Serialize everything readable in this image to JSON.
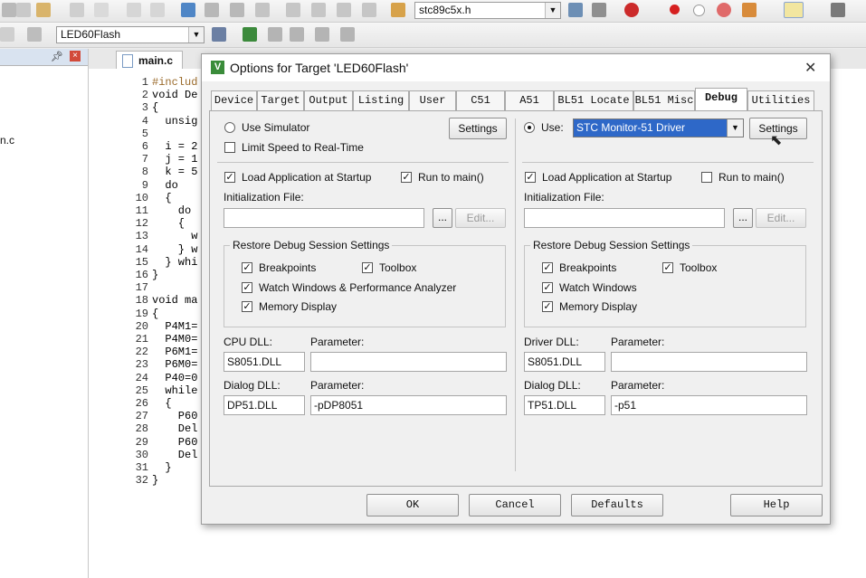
{
  "toolbar1": {
    "file_combo": "stc89c5x.h"
  },
  "toolbar2": {
    "target_combo": "LED60Flash"
  },
  "editor": {
    "file_tab": "main.c",
    "panel_file_fragment": "n.c",
    "line_numbers": [
      "1",
      "2",
      "3",
      "4",
      "5",
      "6",
      "7",
      "8",
      "9",
      "10",
      "11",
      "12",
      "13",
      "14",
      "15",
      "16",
      "17",
      "18",
      "19",
      "20",
      "21",
      "22",
      "23",
      "24",
      "25",
      "26",
      "27",
      "28",
      "29",
      "30",
      "31",
      "32"
    ],
    "code_lines": [
      "#includ",
      "void De",
      "{",
      "  unsig",
      "",
      "  i = 2",
      "  j = 1",
      "  k = 5",
      "  do",
      "  {",
      "    do",
      "    {",
      "      w",
      "    } w",
      "  } whi",
      "}",
      "",
      "void ma",
      "{",
      "  P4M1=",
      "  P4M0=",
      "  P6M1=",
      "  P6M0=",
      "  P40=0",
      "  while",
      "  {",
      "    P60",
      "    Del",
      "    P60",
      "    Del",
      "  }",
      "}"
    ]
  },
  "dialog": {
    "title": "Options for Target 'LED60Flash'",
    "tabs": [
      "Device",
      "Target",
      "Output",
      "Listing",
      "User",
      "C51",
      "A51",
      "BL51 Locate",
      "BL51 Misc",
      "Debug",
      "Utilities"
    ],
    "active_tab": "Debug",
    "left": {
      "use_simulator": "Use Simulator",
      "settings": "Settings",
      "limit_speed": "Limit Speed to Real-Time",
      "load_app": "Load Application at Startup",
      "run_to_main": "Run to main()",
      "init_file": "Initialization File:",
      "browse": "...",
      "edit": "Edit...",
      "restore_group": "Restore Debug Session Settings",
      "breakpoints": "Breakpoints",
      "toolbox": "Toolbox",
      "watch_windows": "Watch Windows & Performance Analyzer",
      "memory_display": "Memory Display",
      "cpu_dll_label": "CPU DLL:",
      "parameter_label": "Parameter:",
      "cpu_dll_value": "S8051.DLL",
      "cpu_param_value": "",
      "dialog_dll_label": "Dialog DLL:",
      "dialog_param_label": "Parameter:",
      "dialog_dll_value": "DP51.DLL",
      "dialog_param_value": "-pDP8051"
    },
    "right": {
      "use_label": "Use:",
      "driver_value": "STC Monitor-51 Driver",
      "settings": "Settings",
      "load_app": "Load Application at Startup",
      "run_to_main": "Run to main()",
      "init_file": "Initialization File:",
      "browse": "...",
      "edit": "Edit...",
      "restore_group": "Restore Debug Session Settings",
      "breakpoints": "Breakpoints",
      "toolbox": "Toolbox",
      "watch_windows": "Watch Windows",
      "memory_display": "Memory Display",
      "driver_dll_label": "Driver DLL:",
      "parameter_label": "Parameter:",
      "driver_dll_value": "S8051.DLL",
      "driver_param_value": "",
      "dialog_dll_label": "Dialog DLL:",
      "dialog_param_label": "Parameter:",
      "dialog_dll_value": "TP51.DLL",
      "dialog_param_value": "-p51"
    },
    "buttons": {
      "ok": "OK",
      "cancel": "Cancel",
      "defaults": "Defaults",
      "help": "Help"
    },
    "close_glyph": "✕",
    "check_glyph": "✓"
  }
}
